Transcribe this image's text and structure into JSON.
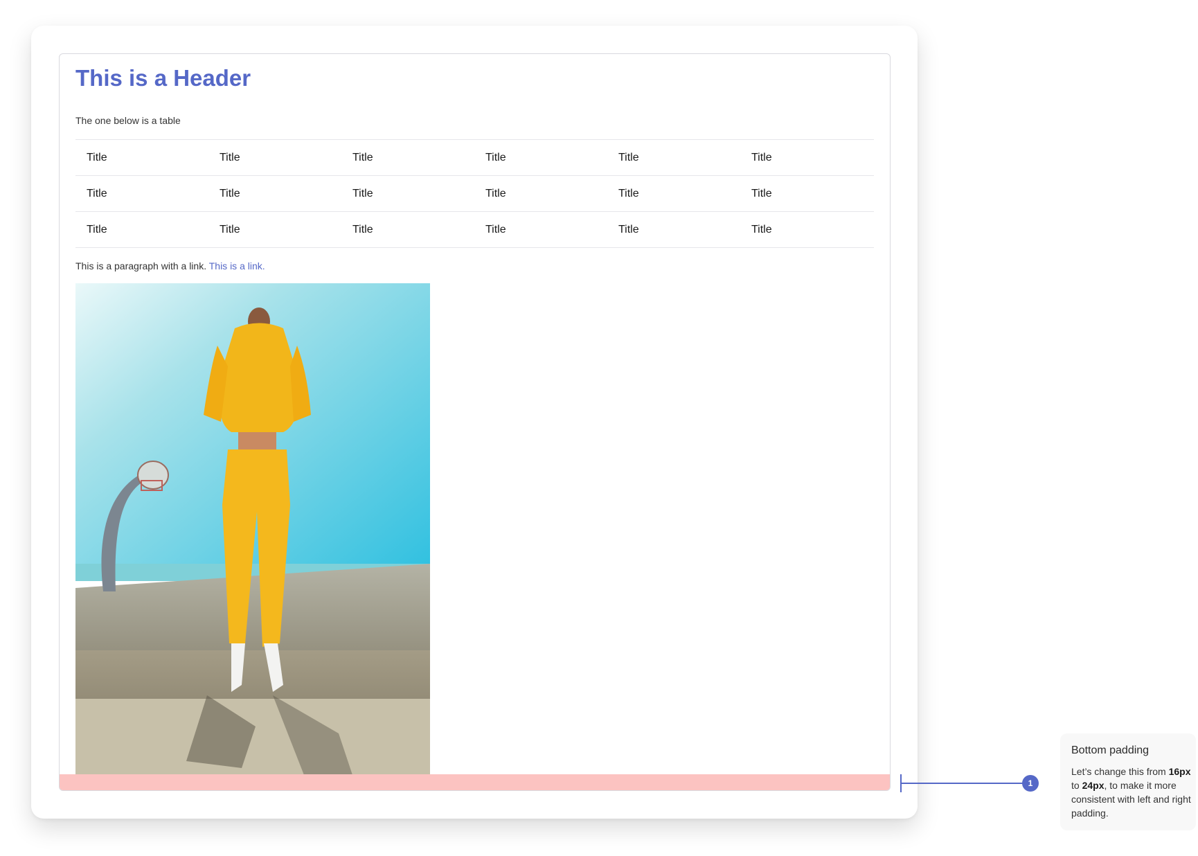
{
  "content": {
    "header": "This is a Header",
    "intro": "The one below is a table",
    "table": {
      "rows": [
        [
          "Title",
          "Title",
          "Title",
          "Title",
          "Title",
          "Title"
        ],
        [
          "Title",
          "Title",
          "Title",
          "Title",
          "Title",
          "Title"
        ],
        [
          "Title",
          "Title",
          "Title",
          "Title",
          "Title",
          "Title"
        ]
      ]
    },
    "paragraph": {
      "text": "This is a paragraph with a link.",
      "link_text": "This is a link."
    },
    "image_icon": "photo-of-woman-in-yellow-tracksuit-at-basketball-court"
  },
  "annotation": {
    "marker_number": "1",
    "title": "Bottom padding",
    "body_part1": "Let’s change this from",
    "from_value": "16px",
    "body_part2": "to",
    "to_value": "24px",
    "body_part3": ", to make it more consistent with left and right padding."
  },
  "colors": {
    "accent": "#5568c7",
    "padding_highlight": "#fcc3c1",
    "note_background": "#f8f8f8"
  }
}
